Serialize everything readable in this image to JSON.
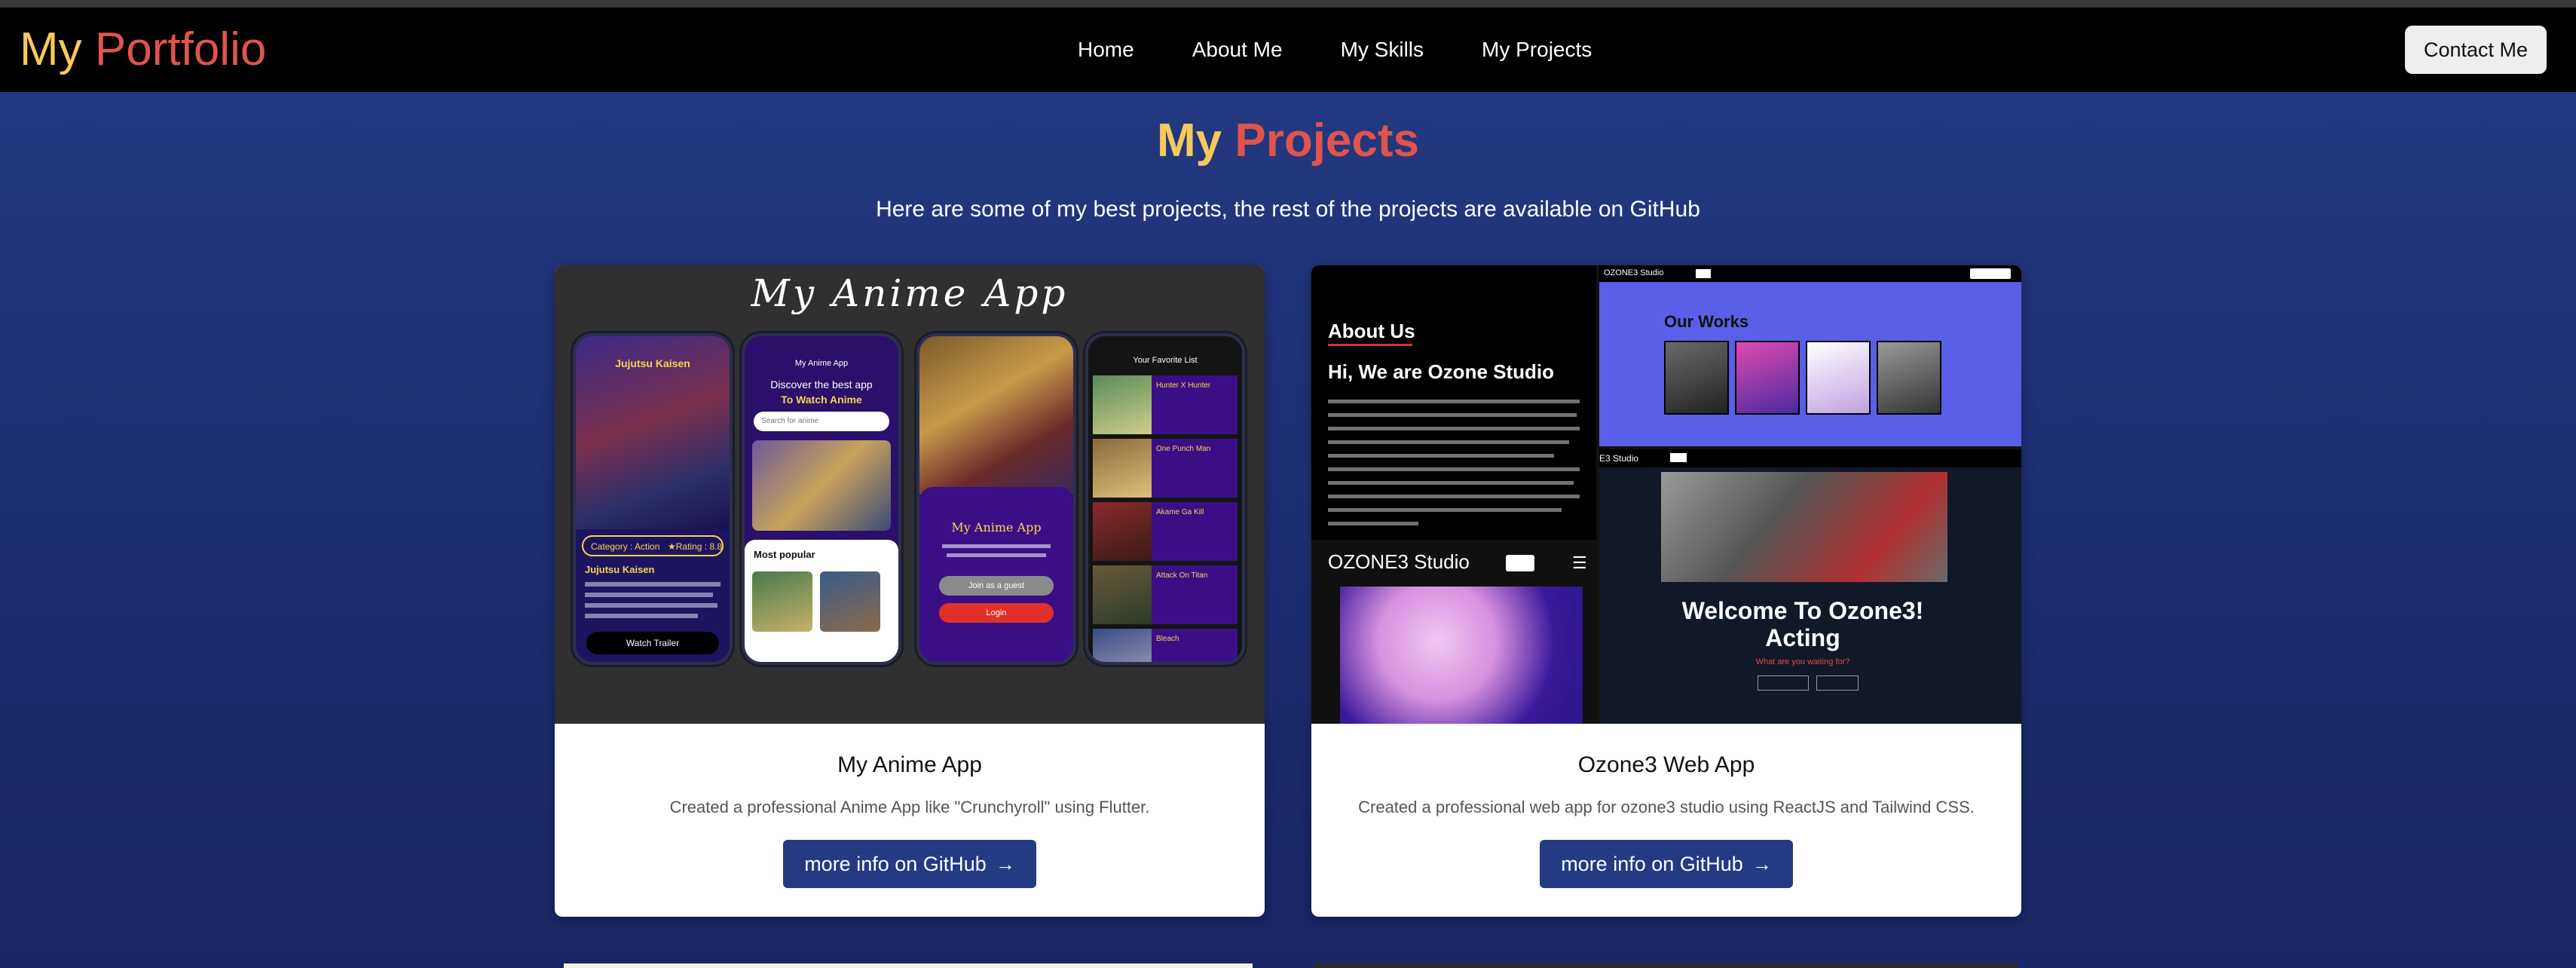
{
  "brand": {
    "logo_first": "My",
    "logo_second": "Portfolio"
  },
  "nav": {
    "links": [
      "Home",
      "About Me",
      "My Skills",
      "My Projects"
    ],
    "contact": "Contact Me"
  },
  "section": {
    "title_first": "My",
    "title_second": "Projects",
    "subtitle": "Here are some of my best projects, the rest of the projects are available on GitHub"
  },
  "projects": [
    {
      "title": "My Anime App",
      "description": "Created a professional Anime App like \"Crunchyroll\" using Flutter.",
      "button": "more info on GitHub",
      "thumb": {
        "heading": "My Anime App",
        "phone1_title": "Jujutsu Kaisen",
        "phone1_category": "Category : Action",
        "phone1_rating": "★Rating : 8.8",
        "phone1_name": "Jujutsu Kaisen",
        "phone1_button": "Watch Trailer",
        "phone2_header": "My Anime App",
        "phone2_line1": "Discover the best app",
        "phone2_line2": "To Watch Anime",
        "phone2_search": "Search for anime",
        "phone2_popular": "Most popular",
        "phone3_title": "My Anime App",
        "phone3_guest": "Join as a guest",
        "phone3_login": "Login",
        "phone4_header": "Your Favorite List",
        "phone4_items": [
          "Hunter X Hunter",
          "One Punch Man",
          "Akame Ga Kill",
          "Attack On Titan",
          "Bleach"
        ]
      }
    },
    {
      "title": "Ozone3 Web App",
      "description": "Created a professional web app for ozone3 studio using ReactJS and Tailwind CSS.",
      "button": "more info on GitHub",
      "thumb": {
        "about_label": "About Us",
        "about_heading": "Hi, We are Ozone Studio",
        "studio_name": "OZONE3 Studio",
        "works_heading": "Our Works",
        "welcome_line1": "Welcome To Ozone3!",
        "welcome_line2": "Acting",
        "welcome_sub": "What are you waiting for?",
        "small_brand": "E3 Studio"
      }
    }
  ]
}
